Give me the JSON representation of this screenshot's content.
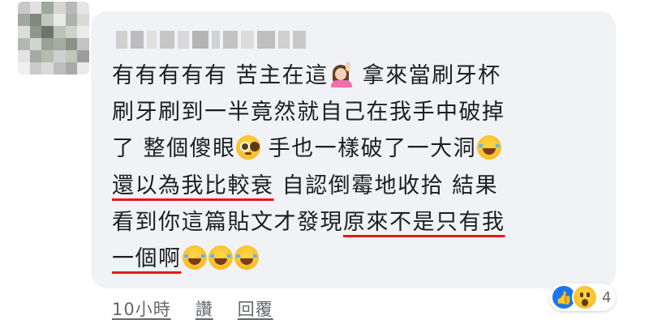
{
  "comment": {
    "lines": [
      {
        "a": "有有有有有 苦主在這",
        "b": " 拿來當刷牙杯"
      },
      {
        "a": "刷牙刷到一半竟然就自己在我手中破掉"
      },
      {
        "a": "了 整個傻眼",
        "b": " 手也一樣破了一大洞"
      },
      {
        "u": "還以為我比較衰",
        "a": " 自認倒霉地收拾 結果"
      },
      {
        "a": "看到你這篇貼文才發現",
        "u": "原來不是只有我"
      },
      {
        "u": "一個啊"
      }
    ]
  },
  "meta": {
    "time": "10小時",
    "like": "讚",
    "reply": "回覆"
  },
  "reactions": {
    "like_icon": "thumbs-up",
    "wow_icon": "wow-face",
    "count": "4",
    "like_color": "#1877f2"
  },
  "colors": {
    "bubble": "#f0f2f5",
    "text": "#1c1e21",
    "underline": "#e31a1a",
    "meta": "#65676b"
  }
}
